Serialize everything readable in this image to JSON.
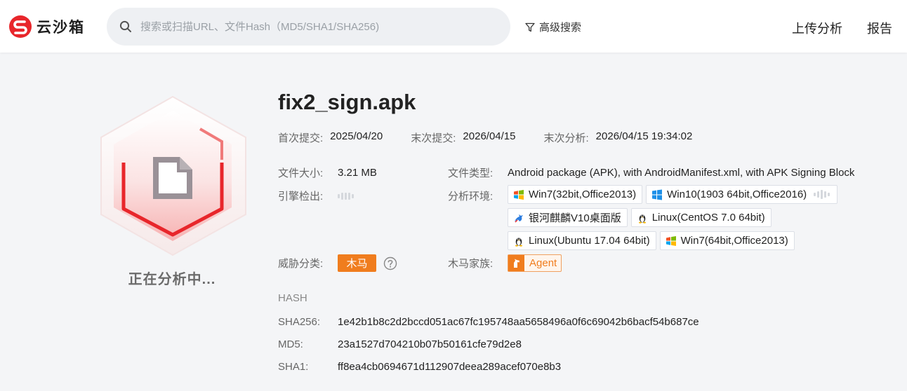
{
  "header": {
    "logo_text": "云沙箱",
    "search_placeholder": "搜索或扫描URL、文件Hash（MD5/SHA1/SHA256)",
    "advanced_search": "高级搜索",
    "nav": {
      "upload": "上传分析",
      "report": "报告"
    }
  },
  "status": {
    "text": "正在分析中..."
  },
  "file": {
    "name": "fix2_sign.apk",
    "first_submit_label": "首次提交:",
    "first_submit": "2025/04/20",
    "last_submit_label": "末次提交:",
    "last_submit": "2026/04/15",
    "last_analysis_label": "末次分析:",
    "last_analysis": "2026/04/15 19:34:02",
    "size_label": "文件大小:",
    "size": "3.21 MB",
    "type_label": "文件类型:",
    "type": "Android package (APK), with AndroidManifest.xml, with APK Signing Block",
    "engine_label": "引擎检出:",
    "env_label": "分析环境:",
    "environments": [
      {
        "label": "Win7(32bit,Office2013)",
        "icon": "windows-flag-icon"
      },
      {
        "label": "Win10(1903 64bit,Office2016)",
        "icon": "windows10-icon"
      },
      {
        "label": "银河麒麟V10桌面版",
        "icon": "kylin-icon"
      },
      {
        "label": "Linux(CentOS 7.0 64bit)",
        "icon": "linux-tux-icon"
      },
      {
        "label": "Linux(Ubuntu 17.04 64bit)",
        "icon": "linux-tux-icon"
      },
      {
        "label": "Win7(64bit,Office2013)",
        "icon": "windows-flag-icon"
      }
    ],
    "threat_label": "威胁分类:",
    "threat": "木马",
    "family_label": "木马家族:",
    "family": "Agent"
  },
  "hash": {
    "title": "HASH",
    "sha256_label": "SHA256:",
    "sha256": "1e42b1b8c2d2bccd051ac67fc195748aa5658496a0f6c69042b6bacf54b687ce",
    "md5_label": "MD5:",
    "md5": "23a1527d704210b07b50161cfe79d2e8",
    "sha1_label": "SHA1:",
    "sha1": "ff8ea4cb0694671d112907deea289acef070e8b3"
  },
  "colors": {
    "brand_red": "#e8262b",
    "trojan_orange": "#f07d1e",
    "background": "#f4f5f7"
  }
}
